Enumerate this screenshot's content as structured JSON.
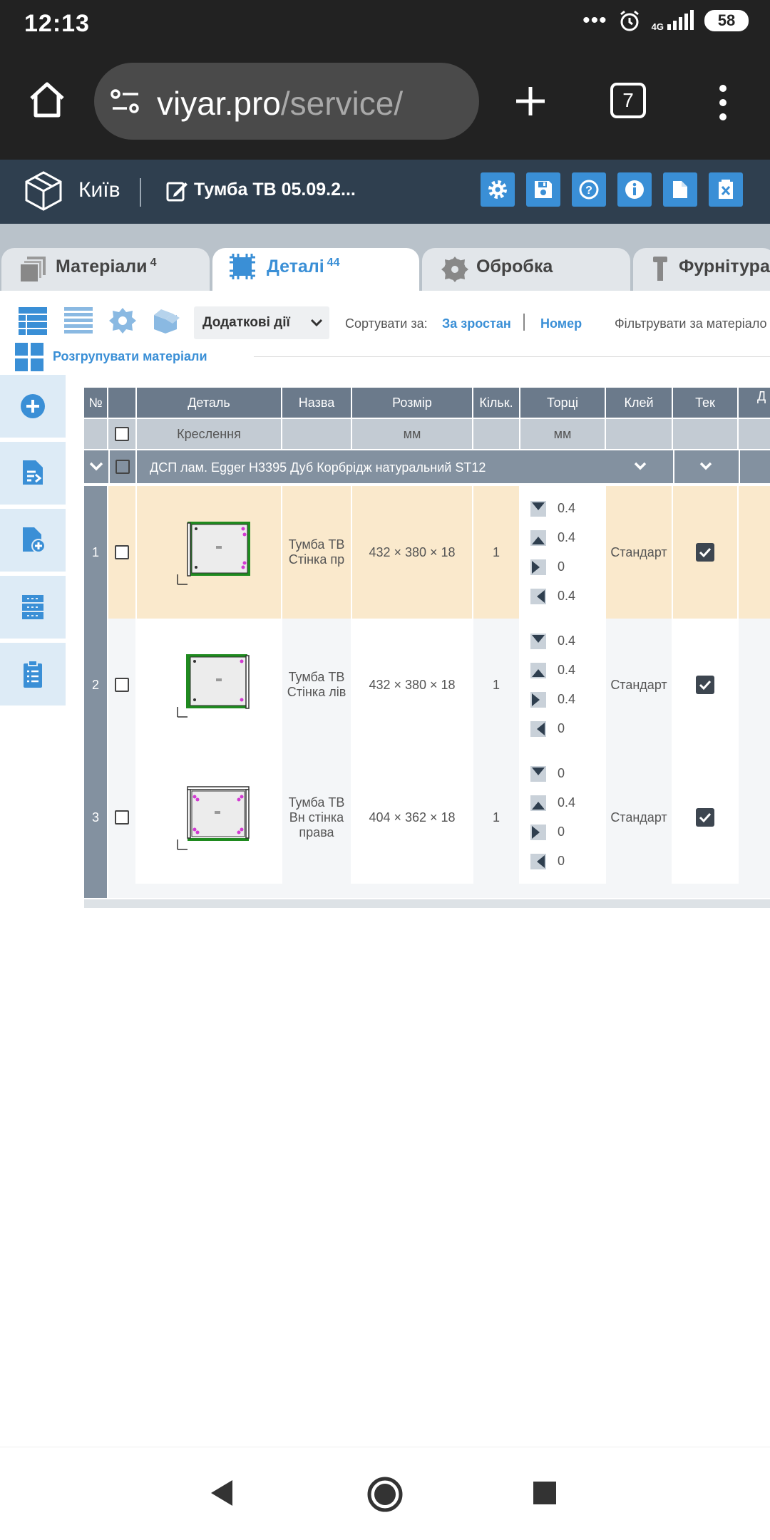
{
  "status_bar": {
    "time": "12:13",
    "network": "4G",
    "battery": "58"
  },
  "browser": {
    "url_host": "viyar.pro",
    "url_path": "/service/",
    "tab_count": "7"
  },
  "app_header": {
    "city": "Київ",
    "document_title": "Тумба ТВ 05.09.2...",
    "buttons": [
      "settings",
      "save",
      "help",
      "info",
      "new-document",
      "delete"
    ]
  },
  "tabs": [
    {
      "label": "Матеріали",
      "badge": "4"
    },
    {
      "label": "Деталі",
      "badge": "44"
    },
    {
      "label": "Обробка",
      "badge": ""
    },
    {
      "label": "Фурнітура",
      "badge": ""
    }
  ],
  "toolbar": {
    "dropdown": "Додаткові дії",
    "sort_label": "Сортувати за:",
    "sort_asc": "За зростан",
    "sort_number": "Номер",
    "filter_label": "Фільтрувати за матеріало",
    "ungroup": "Розгрупувати матеріали"
  },
  "table": {
    "headers": [
      "№",
      "",
      "Деталь",
      "Назва",
      "Розмір",
      "Кільк.",
      "Торці",
      "Клей",
      "Тек",
      "Д"
    ],
    "subheaders": [
      "",
      "",
      "Креслення",
      "",
      "мм",
      "",
      "мм",
      "",
      "",
      ""
    ],
    "group_label": "ДСП лам. Egger H3395 Дуб Корбрідж натуральний ST12",
    "rows": [
      {
        "num": "1",
        "name": "Тумба ТВ Стінка пр",
        "size": "432 × 380 × 18",
        "qty": "1",
        "edges": [
          "0.4",
          "0.4",
          "0",
          "0.4"
        ],
        "glue": "Стандарт",
        "highlight": true
      },
      {
        "num": "2",
        "name": "Тумба ТВ Стінка лів",
        "size": "432 × 380 × 18",
        "qty": "1",
        "edges": [
          "0.4",
          "0.4",
          "0.4",
          "0"
        ],
        "glue": "Стандарт",
        "highlight": false
      },
      {
        "num": "3",
        "name": "Тумба ТВ Вн стінка права",
        "size": "404 × 362 × 18",
        "qty": "1",
        "edges": [
          "0",
          "0.4",
          "0",
          "0"
        ],
        "glue": "Стандарт",
        "highlight": false
      }
    ]
  },
  "colors": {
    "accent": "#3a8fd6",
    "header_bg": "#2f3f4f",
    "highlight_row": "#fae9cc",
    "edge_green": "#1f8a1f"
  }
}
